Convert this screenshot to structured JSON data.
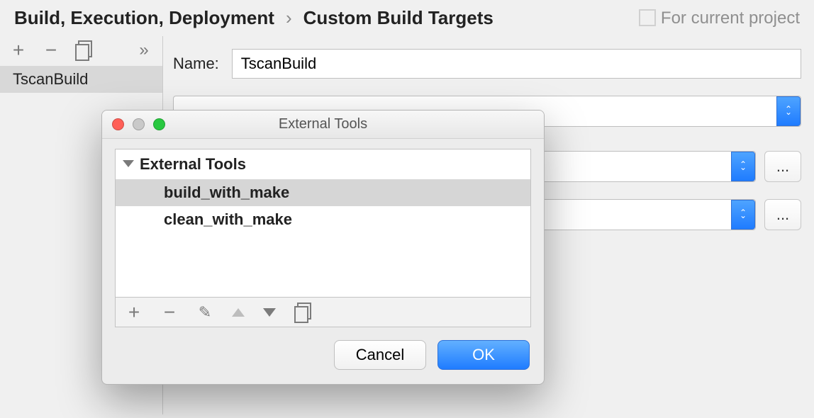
{
  "breadcrumb": {
    "part1": "Build, Execution, Deployment",
    "separator": "›",
    "part2": "Custom Build Targets"
  },
  "scope_label": "For current project",
  "left": {
    "selected_item": "TscanBuild"
  },
  "form": {
    "name_label": "Name:",
    "name_value": "TscanBuild"
  },
  "dots": "...",
  "dialog": {
    "title": "External Tools",
    "tree_header": "External Tools",
    "items": [
      {
        "label": "build_with_make",
        "selected": true
      },
      {
        "label": "clean_with_make",
        "selected": false
      }
    ],
    "cancel": "Cancel",
    "ok": "OK"
  }
}
